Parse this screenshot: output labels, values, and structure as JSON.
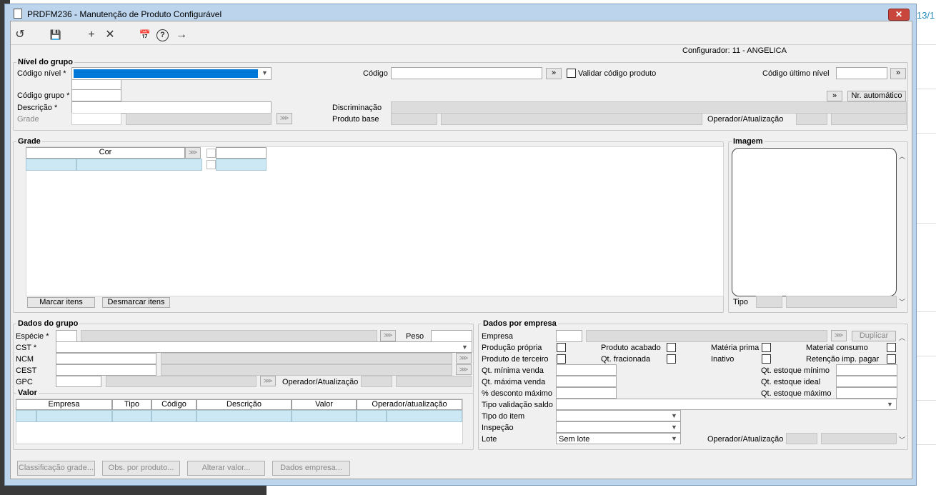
{
  "window": {
    "title": "PRDFM236 - Manutenção de Produto Configurável",
    "close_label": "✕"
  },
  "background": {
    "number_text": "13/1"
  },
  "toolbar": {
    "undo_icon": "↺",
    "save_icon": "💾",
    "add_icon": "+",
    "delete_icon": "✕",
    "calendar_icon": "📅",
    "help_icon": "?",
    "exit_icon": "→"
  },
  "configurador": "Configurador: 11 - ANGELICA",
  "nivel": {
    "title": "Nível do grupo",
    "codigo_nivel_label": "Código nível *",
    "codigo_label": "Código",
    "validar_label": "Validar código produto",
    "codigo_ultimo_label": "Código último nível",
    "codigo_grupo_label": "Código grupo *",
    "descricao_label": "Descrição *",
    "grade_label": "Grade",
    "discriminacao_label": "Discriminação",
    "produto_base_label": "Produto base",
    "operador_label": "Operador/Atualização",
    "nr_automatico_label": "Nr. automático",
    "arrow": "»"
  },
  "grade": {
    "title": "Grade",
    "column": "Cor",
    "marcar_label": "Marcar itens",
    "desmarcar_label": "Desmarcar itens"
  },
  "imagem": {
    "title": "Imagem",
    "tipo_label": "Tipo"
  },
  "dados_grupo": {
    "title": "Dados do grupo",
    "especie_label": "Espécie *",
    "peso_label": "Peso",
    "cst_label": "CST *",
    "ncm_label": "NCM",
    "cest_label": "CEST",
    "gpc_label": "GPC",
    "operador_label": "Operador/Atualização"
  },
  "valor": {
    "title": "Valor",
    "columns": [
      "Empresa",
      "Tipo",
      "Código",
      "Descrição",
      "Valor",
      "Operador/atualização"
    ]
  },
  "dados_empresa": {
    "title": "Dados por empresa",
    "empresa_label": "Empresa",
    "duplicar_label": "Duplicar",
    "producao_propria": "Produção própria",
    "produto_acabado": "Produto acabado",
    "materia_prima": "Matéria prima",
    "material_consumo": "Material consumo",
    "produto_terceiro": "Produto de terceiro",
    "qt_fracionada": "Qt. fracionada",
    "inativo": "Inativo",
    "retencao": "Retenção imp. pagar",
    "qt_minima": "Qt. mínima venda",
    "qt_maxima": "Qt. máxima venda",
    "desconto": "% desconto máximo",
    "estoque_min": "Qt. estoque mínimo",
    "estoque_ideal": "Qt. estoque ideal",
    "estoque_max": "Qt. estoque máximo",
    "tipo_validacao": "Tipo validação saldo",
    "tipo_item": "Tipo do item",
    "inspecao": "Inspeção",
    "lote": "Lote",
    "lote_value": "Sem lote",
    "operador_label": "Operador/Atualização"
  },
  "footer": {
    "classificacao": "Classificação grade...",
    "obs": "Obs. por produto...",
    "alterar": "Alterar valor...",
    "dados_empresa": "Dados empresa..."
  }
}
